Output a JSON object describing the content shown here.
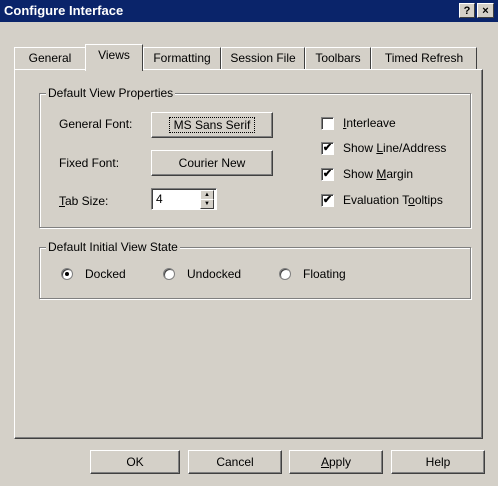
{
  "window": {
    "title": "Configure Interface"
  },
  "titlebar": {
    "help_label": "?",
    "close_label": "×"
  },
  "tabs": [
    {
      "label": "General"
    },
    {
      "label": "Views"
    },
    {
      "label": "Formatting"
    },
    {
      "label": "Session File"
    },
    {
      "label": "Toolbars"
    },
    {
      "label": "Timed Refresh"
    }
  ],
  "active_tab": "Views",
  "view_props": {
    "group_label": "Default View Properties",
    "general_font_label": "General Font:",
    "general_font_value": "MS Sans Serif",
    "fixed_font_label": "Fixed Font:",
    "fixed_font_value": "Courier New",
    "tab_size_label_pre": "",
    "tab_size_label_u": "T",
    "tab_size_label_post": "ab Size:",
    "tab_size_value": "4"
  },
  "checkboxes": [
    {
      "pre": "",
      "u": "I",
      "post": "nterleave",
      "checked": false
    },
    {
      "pre": "Show ",
      "u": "L",
      "post": "ine/Address",
      "checked": true
    },
    {
      "pre": "Show ",
      "u": "M",
      "post": "argin",
      "checked": true
    },
    {
      "pre": "Evaluation T",
      "u": "o",
      "post": "oltips",
      "checked": true
    }
  ],
  "view_state": {
    "group_label": "Default Initial View State",
    "options": [
      {
        "label": "Docked",
        "selected": true
      },
      {
        "label": "Undocked",
        "selected": false
      },
      {
        "label": "Floating",
        "selected": false
      }
    ]
  },
  "buttons": {
    "ok": "OK",
    "cancel": "Cancel",
    "apply_u": "A",
    "apply_post": "pply",
    "help": "Help"
  }
}
